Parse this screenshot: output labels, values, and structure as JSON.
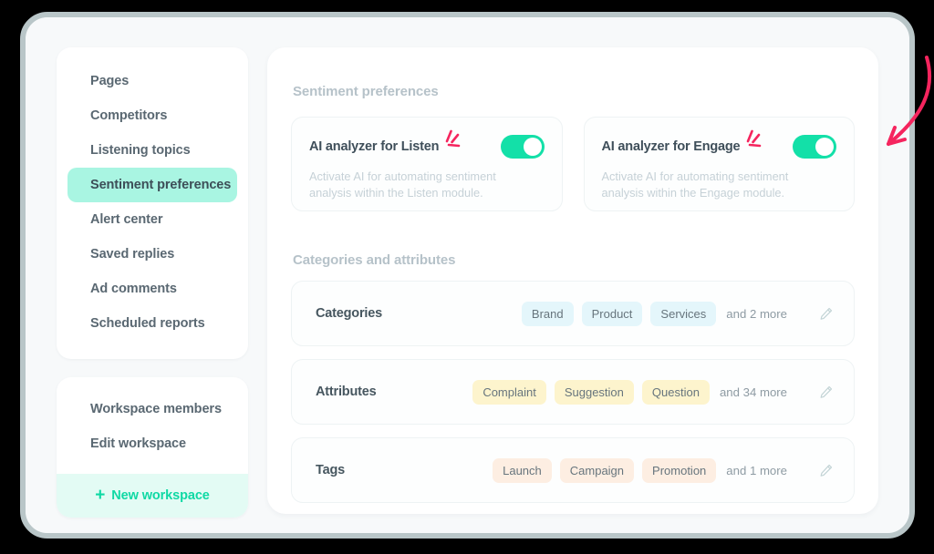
{
  "theme": {
    "background": "#000000",
    "frame_border": "#b9c6c8",
    "panel_bg": "#ffffff",
    "app_bg": "#f7f9fa",
    "accent_teal": "#13e0a8",
    "accent_mint": "#a9f5e2",
    "annotation_red": "#f5255e",
    "heading_muted": "#b6c2c9",
    "text_dark": "#3f4f5a"
  },
  "sidebar": {
    "nav_items": [
      {
        "label": "Pages",
        "active": false
      },
      {
        "label": "Competitors",
        "active": false
      },
      {
        "label": "Listening topics",
        "active": false
      },
      {
        "label": "Sentiment preferences",
        "active": true
      },
      {
        "label": "Alert center",
        "active": false
      },
      {
        "label": "Saved replies",
        "active": false
      },
      {
        "label": "Ad comments",
        "active": false
      },
      {
        "label": "Scheduled reports",
        "active": false
      }
    ],
    "workspace_items": [
      {
        "label": "Workspace members"
      },
      {
        "label": "Edit workspace"
      }
    ],
    "new_workspace": {
      "label": "New workspace",
      "plus_glyph": "+",
      "icon": "plus-icon"
    }
  },
  "main": {
    "sentiment_section": {
      "title": "Sentiment preferences",
      "cards": [
        {
          "title": "AI analyzer for Listen",
          "description": "Activate AI for automating sentiment analysis within the Listen module.",
          "toggle_on": true,
          "annotation": "sparkle-burst"
        },
        {
          "title": "AI analyzer for Engage",
          "description": "Activate AI for automating sentiment analysis within the Engage module.",
          "toggle_on": true,
          "annotation": "sparkle-burst"
        }
      ]
    },
    "categories_section": {
      "title": "Categories and attributes",
      "rows": [
        {
          "label": "Categories",
          "chip_style": "blue",
          "chips": [
            "Brand",
            "Product",
            "Services"
          ],
          "more": "and 2 more",
          "edit_icon": "pencil-icon"
        },
        {
          "label": "Attributes",
          "chip_style": "yellow",
          "chips": [
            "Complaint",
            "Suggestion",
            "Question"
          ],
          "more": "and 34 more",
          "edit_icon": "pencil-icon"
        },
        {
          "label": "Tags",
          "chip_style": "peach",
          "chips": [
            "Launch",
            "Campaign",
            "Promotion"
          ],
          "more": "and 1 more",
          "edit_icon": "pencil-icon"
        }
      ]
    }
  },
  "annotations": {
    "arrow": {
      "name": "callout-arrow",
      "color": "#f5255e",
      "direction": "down-left",
      "points_to": "AI analyzer for Engage toggle"
    }
  }
}
